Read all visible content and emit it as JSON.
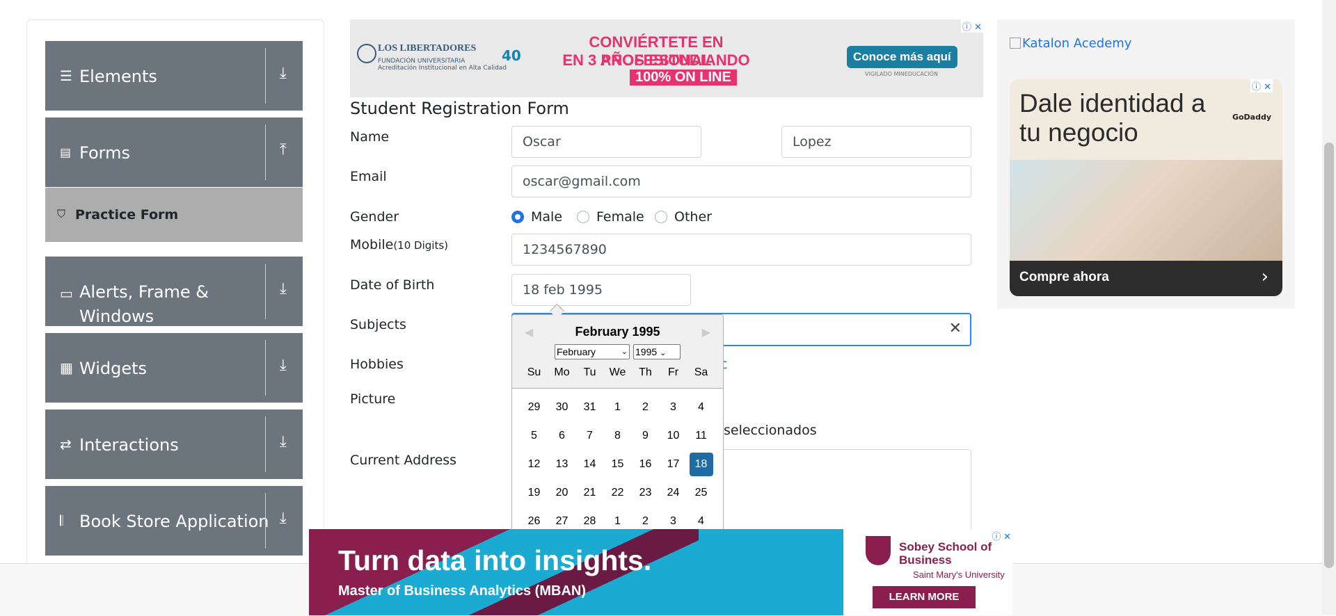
{
  "sidebar": {
    "groups": [
      {
        "label": "Elements",
        "icon": "menu-icon"
      },
      {
        "label": "Forms",
        "icon": "document-icon"
      },
      {
        "label": "Alerts, Frame & Windows",
        "icon": "window-icon"
      },
      {
        "label": "Widgets",
        "icon": "grid-icon"
      },
      {
        "label": "Interactions",
        "icon": "swap-icon"
      },
      {
        "label": "Book Store Application",
        "icon": "books-icon"
      }
    ],
    "active_item": {
      "label": "Practice Form",
      "icon": "html5-icon"
    }
  },
  "top_ad": {
    "brand": "LOS LIBERTADORES",
    "brand_sub1": "FUNDACIÓN UNIVERSITARIA",
    "brand_sub2": "Acreditación Institucional en Alta Calidad",
    "anniversary": "40",
    "line1": "CONVIÉRTETE EN PROFESIONAL",
    "line2": "EN 3 AÑOS ESTUDIANDO",
    "line3": "100% ON LINE",
    "cta": "Conoce más aquí",
    "cta_sub": "VIGILADO MINEDUCACIÓN"
  },
  "form": {
    "title": "Student Registration Form",
    "labels": {
      "name": "Name",
      "email": "Email",
      "gender": "Gender",
      "mobile": "Mobile",
      "mobile_hint": "(10 Digits)",
      "dob": "Date of Birth",
      "subjects": "Subjects",
      "hobbies": "Hobbies",
      "picture": "Picture",
      "address": "Current Address"
    },
    "first_name": "Oscar",
    "last_name": "Lopez",
    "email": "oscar@gmail.com",
    "gender_options": [
      "Male",
      "Female",
      "Other"
    ],
    "gender_selected": "Male",
    "mobile": "1234567890",
    "dob": "18 feb 1995",
    "hobbies_partial": "c",
    "picture_partial": "seleccionados"
  },
  "datepicker": {
    "title": "February 1995",
    "month_select": "February",
    "year_select": "1995",
    "weekdays": [
      "Su",
      "Mo",
      "Tu",
      "We",
      "Th",
      "Fr",
      "Sa"
    ],
    "weeks": [
      [
        "29",
        "30",
        "31",
        "1",
        "2",
        "3",
        "4"
      ],
      [
        "5",
        "6",
        "7",
        "8",
        "9",
        "10",
        "11"
      ],
      [
        "12",
        "13",
        "14",
        "15",
        "16",
        "17",
        "18"
      ],
      [
        "19",
        "20",
        "21",
        "22",
        "23",
        "24",
        "25"
      ],
      [
        "26",
        "27",
        "28",
        "1",
        "2",
        "3",
        "4"
      ]
    ],
    "selected_day": "18"
  },
  "right_ad": {
    "katalon_alt": "Katalon Acedemy",
    "headline": "Dale identidad a tu negocio",
    "brand": "GoDaddy",
    "cta": "Compre ahora"
  },
  "bottom_ad": {
    "headline": "Turn data into insights.",
    "subline": "Master of Business Analytics (MBAN)",
    "school": "Sobey School of Business",
    "university": "Saint Mary's University",
    "cta": "LEARN MORE"
  },
  "colors": {
    "sidebar_group_bg": "#6c757d",
    "sidebar_active_bg": "#adadad",
    "primary": "#1a73e8",
    "datepicker_selected": "#216ba5",
    "ad_pink": "#e6326e",
    "ad_maroon": "#8a1f4f",
    "ad_cyan": "#1aaad2"
  }
}
